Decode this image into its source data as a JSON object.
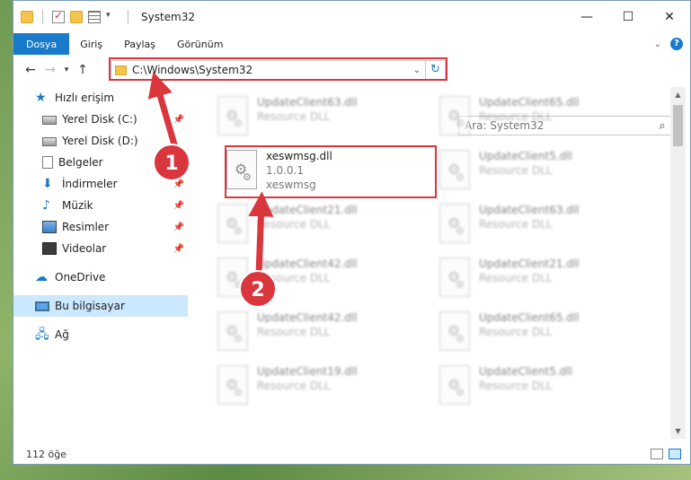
{
  "window": {
    "title": "System32",
    "caption": {
      "minimize": "—",
      "maximize": "☐",
      "close": "✕"
    }
  },
  "ribbon": {
    "tabs": [
      "Dosya",
      "Giriş",
      "Paylaş",
      "Görünüm"
    ]
  },
  "navigation": {
    "address": "C:\\Windows\\System32",
    "search_placeholder": "Ara: System32"
  },
  "sidebar": {
    "items": [
      {
        "label": "Hızlı erişim",
        "icon": "star-icon"
      },
      {
        "label": "Yerel Disk (C:)",
        "icon": "disk-icon",
        "pinned": true
      },
      {
        "label": "Yerel Disk (D:)",
        "icon": "disk-icon",
        "pinned": true
      },
      {
        "label": "Belgeler",
        "icon": "documents-icon",
        "pinned": true
      },
      {
        "label": "İndirmeler",
        "icon": "downloads-icon",
        "pinned": true
      },
      {
        "label": "Müzik",
        "icon": "music-icon",
        "pinned": true
      },
      {
        "label": "Resimler",
        "icon": "pictures-icon",
        "pinned": true
      },
      {
        "label": "Videolar",
        "icon": "videos-icon",
        "pinned": true
      },
      {
        "label": "OneDrive",
        "icon": "cloud-icon"
      },
      {
        "label": "Bu bilgisayar",
        "icon": "computer-icon",
        "selected": true
      },
      {
        "label": "Ağ",
        "icon": "network-icon"
      }
    ]
  },
  "files": [
    {
      "name": "UpdateClient63.dll",
      "type": "Resource DLL"
    },
    {
      "name": "UpdateClient65.dll",
      "type": "Resource DLL"
    },
    {
      "name": "xeswmsg.dll",
      "version": "1.0.0.1",
      "type": "xeswmsg"
    },
    {
      "name": "UpdateClient5.dll",
      "type": "Resource DLL"
    },
    {
      "name": "UpdateClient21.dll",
      "type": "Resource DLL"
    },
    {
      "name": "UpdateClient63.dll",
      "type": "Resource DLL"
    },
    {
      "name": "UpdateClient42.dll",
      "type": "Resource DLL"
    },
    {
      "name": "UpdateClient21.dll",
      "type": "Resource DLL"
    },
    {
      "name": "UpdateClient42.dll",
      "type": "Resource DLL"
    },
    {
      "name": "UpdateClient65.dll",
      "type": "Resource DLL"
    },
    {
      "name": "UpdateClient19.dll",
      "type": "Resource DLL"
    },
    {
      "name": "UpdateClient5.dll",
      "type": "Resource DLL"
    }
  ],
  "status": {
    "item_count": "112 öğe"
  },
  "annotations": {
    "step1": "1",
    "step2": "2",
    "color": "#d9363e"
  }
}
